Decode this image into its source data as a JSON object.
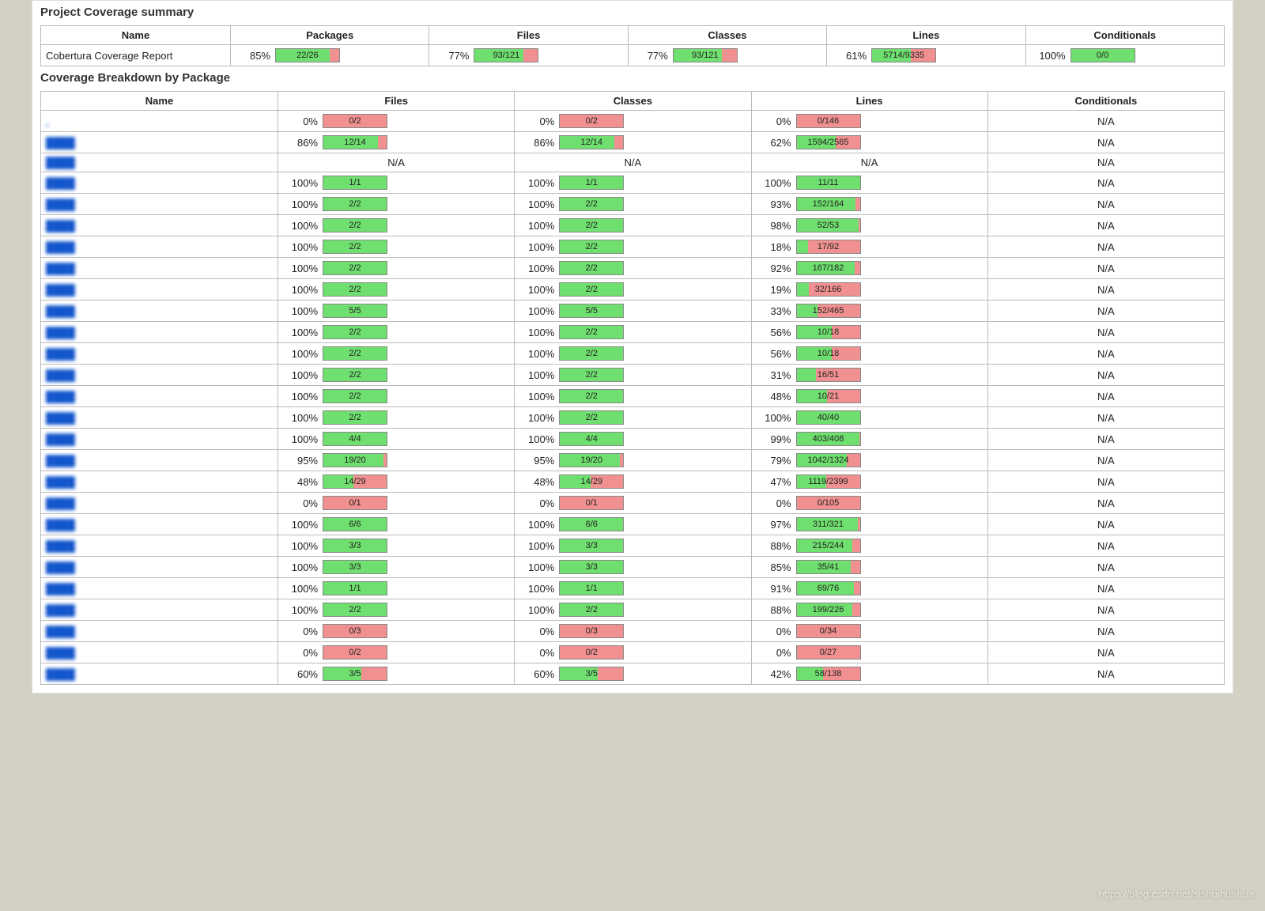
{
  "watermark": "https://blog.csdn.net/sishuihuahua",
  "summary": {
    "title": "Project Coverage summary",
    "headers": [
      "Name",
      "Packages",
      "Files",
      "Classes",
      "Lines",
      "Conditionals"
    ],
    "row": {
      "name": "Cobertura Coverage Report",
      "metrics": [
        {
          "pct": 85,
          "num": 22,
          "den": 26
        },
        {
          "pct": 77,
          "num": 93,
          "den": 121
        },
        {
          "pct": 77,
          "num": 93,
          "den": 121
        },
        {
          "pct": 61,
          "num": 5714,
          "den": 9335
        },
        {
          "pct": 100,
          "num": 0,
          "den": 0
        }
      ]
    }
  },
  "breakdown": {
    "title": "Coverage Breakdown by Package",
    "headers": [
      "Name",
      "Files",
      "Classes",
      "Lines",
      "Conditionals"
    ],
    "rows": [
      {
        "name": ".",
        "files": {
          "pct": 0,
          "num": 0,
          "den": 2
        },
        "classes": {
          "pct": 0,
          "num": 0,
          "den": 2
        },
        "lines": {
          "pct": 0,
          "num": 0,
          "den": 146
        },
        "cond": "N/A"
      },
      {
        "name": "████",
        "files": {
          "pct": 86,
          "num": 12,
          "den": 14
        },
        "classes": {
          "pct": 86,
          "num": 12,
          "den": 14
        },
        "lines": {
          "pct": 62,
          "num": 1594,
          "den": 2565
        },
        "cond": "N/A"
      },
      {
        "name": "████",
        "files": "N/A",
        "classes": "N/A",
        "lines": "N/A",
        "cond": "N/A"
      },
      {
        "name": "████",
        "files": {
          "pct": 100,
          "num": 1,
          "den": 1
        },
        "classes": {
          "pct": 100,
          "num": 1,
          "den": 1
        },
        "lines": {
          "pct": 100,
          "num": 11,
          "den": 11
        },
        "cond": "N/A"
      },
      {
        "name": "████",
        "files": {
          "pct": 100,
          "num": 2,
          "den": 2
        },
        "classes": {
          "pct": 100,
          "num": 2,
          "den": 2
        },
        "lines": {
          "pct": 93,
          "num": 152,
          "den": 164
        },
        "cond": "N/A"
      },
      {
        "name": "████",
        "files": {
          "pct": 100,
          "num": 2,
          "den": 2
        },
        "classes": {
          "pct": 100,
          "num": 2,
          "den": 2
        },
        "lines": {
          "pct": 98,
          "num": 52,
          "den": 53
        },
        "cond": "N/A"
      },
      {
        "name": "████",
        "files": {
          "pct": 100,
          "num": 2,
          "den": 2
        },
        "classes": {
          "pct": 100,
          "num": 2,
          "den": 2
        },
        "lines": {
          "pct": 18,
          "num": 17,
          "den": 92
        },
        "cond": "N/A"
      },
      {
        "name": "████",
        "files": {
          "pct": 100,
          "num": 2,
          "den": 2
        },
        "classes": {
          "pct": 100,
          "num": 2,
          "den": 2
        },
        "lines": {
          "pct": 92,
          "num": 167,
          "den": 182
        },
        "cond": "N/A"
      },
      {
        "name": "████",
        "files": {
          "pct": 100,
          "num": 2,
          "den": 2
        },
        "classes": {
          "pct": 100,
          "num": 2,
          "den": 2
        },
        "lines": {
          "pct": 19,
          "num": 32,
          "den": 166
        },
        "cond": "N/A"
      },
      {
        "name": "████",
        "files": {
          "pct": 100,
          "num": 5,
          "den": 5
        },
        "classes": {
          "pct": 100,
          "num": 5,
          "den": 5
        },
        "lines": {
          "pct": 33,
          "num": 152,
          "den": 465
        },
        "cond": "N/A"
      },
      {
        "name": "████",
        "files": {
          "pct": 100,
          "num": 2,
          "den": 2
        },
        "classes": {
          "pct": 100,
          "num": 2,
          "den": 2
        },
        "lines": {
          "pct": 56,
          "num": 10,
          "den": 18
        },
        "cond": "N/A"
      },
      {
        "name": "████",
        "files": {
          "pct": 100,
          "num": 2,
          "den": 2
        },
        "classes": {
          "pct": 100,
          "num": 2,
          "den": 2
        },
        "lines": {
          "pct": 56,
          "num": 10,
          "den": 18
        },
        "cond": "N/A"
      },
      {
        "name": "████",
        "files": {
          "pct": 100,
          "num": 2,
          "den": 2
        },
        "classes": {
          "pct": 100,
          "num": 2,
          "den": 2
        },
        "lines": {
          "pct": 31,
          "num": 16,
          "den": 51
        },
        "cond": "N/A"
      },
      {
        "name": "████",
        "files": {
          "pct": 100,
          "num": 2,
          "den": 2
        },
        "classes": {
          "pct": 100,
          "num": 2,
          "den": 2
        },
        "lines": {
          "pct": 48,
          "num": 10,
          "den": 21
        },
        "cond": "N/A"
      },
      {
        "name": "████",
        "files": {
          "pct": 100,
          "num": 2,
          "den": 2
        },
        "classes": {
          "pct": 100,
          "num": 2,
          "den": 2
        },
        "lines": {
          "pct": 100,
          "num": 40,
          "den": 40
        },
        "cond": "N/A"
      },
      {
        "name": "████",
        "files": {
          "pct": 100,
          "num": 4,
          "den": 4
        },
        "classes": {
          "pct": 100,
          "num": 4,
          "den": 4
        },
        "lines": {
          "pct": 99,
          "num": 403,
          "den": 408
        },
        "cond": "N/A"
      },
      {
        "name": "████",
        "files": {
          "pct": 95,
          "num": 19,
          "den": 20
        },
        "classes": {
          "pct": 95,
          "num": 19,
          "den": 20
        },
        "lines": {
          "pct": 79,
          "num": 1042,
          "den": 1324
        },
        "cond": "N/A"
      },
      {
        "name": "████",
        "files": {
          "pct": 48,
          "num": 14,
          "den": 29
        },
        "classes": {
          "pct": 48,
          "num": 14,
          "den": 29
        },
        "lines": {
          "pct": 47,
          "num": 1119,
          "den": 2399
        },
        "cond": "N/A"
      },
      {
        "name": "████",
        "files": {
          "pct": 0,
          "num": 0,
          "den": 1
        },
        "classes": {
          "pct": 0,
          "num": 0,
          "den": 1
        },
        "lines": {
          "pct": 0,
          "num": 0,
          "den": 105
        },
        "cond": "N/A"
      },
      {
        "name": "████",
        "files": {
          "pct": 100,
          "num": 6,
          "den": 6
        },
        "classes": {
          "pct": 100,
          "num": 6,
          "den": 6
        },
        "lines": {
          "pct": 97,
          "num": 311,
          "den": 321
        },
        "cond": "N/A"
      },
      {
        "name": "████",
        "files": {
          "pct": 100,
          "num": 3,
          "den": 3
        },
        "classes": {
          "pct": 100,
          "num": 3,
          "den": 3
        },
        "lines": {
          "pct": 88,
          "num": 215,
          "den": 244
        },
        "cond": "N/A"
      },
      {
        "name": "████",
        "files": {
          "pct": 100,
          "num": 3,
          "den": 3
        },
        "classes": {
          "pct": 100,
          "num": 3,
          "den": 3
        },
        "lines": {
          "pct": 85,
          "num": 35,
          "den": 41
        },
        "cond": "N/A"
      },
      {
        "name": "████",
        "files": {
          "pct": 100,
          "num": 1,
          "den": 1
        },
        "classes": {
          "pct": 100,
          "num": 1,
          "den": 1
        },
        "lines": {
          "pct": 91,
          "num": 69,
          "den": 76
        },
        "cond": "N/A"
      },
      {
        "name": "████",
        "files": {
          "pct": 100,
          "num": 2,
          "den": 2
        },
        "classes": {
          "pct": 100,
          "num": 2,
          "den": 2
        },
        "lines": {
          "pct": 88,
          "num": 199,
          "den": 226
        },
        "cond": "N/A"
      },
      {
        "name": "████",
        "files": {
          "pct": 0,
          "num": 0,
          "den": 3
        },
        "classes": {
          "pct": 0,
          "num": 0,
          "den": 3
        },
        "lines": {
          "pct": 0,
          "num": 0,
          "den": 34
        },
        "cond": "N/A"
      },
      {
        "name": "████",
        "files": {
          "pct": 0,
          "num": 0,
          "den": 2
        },
        "classes": {
          "pct": 0,
          "num": 0,
          "den": 2
        },
        "lines": {
          "pct": 0,
          "num": 0,
          "den": 27
        },
        "cond": "N/A"
      },
      {
        "name": "████",
        "files": {
          "pct": 60,
          "num": 3,
          "den": 5
        },
        "classes": {
          "pct": 60,
          "num": 3,
          "den": 5
        },
        "lines": {
          "pct": 42,
          "num": 58,
          "den": 138
        },
        "cond": "N/A"
      }
    ]
  }
}
